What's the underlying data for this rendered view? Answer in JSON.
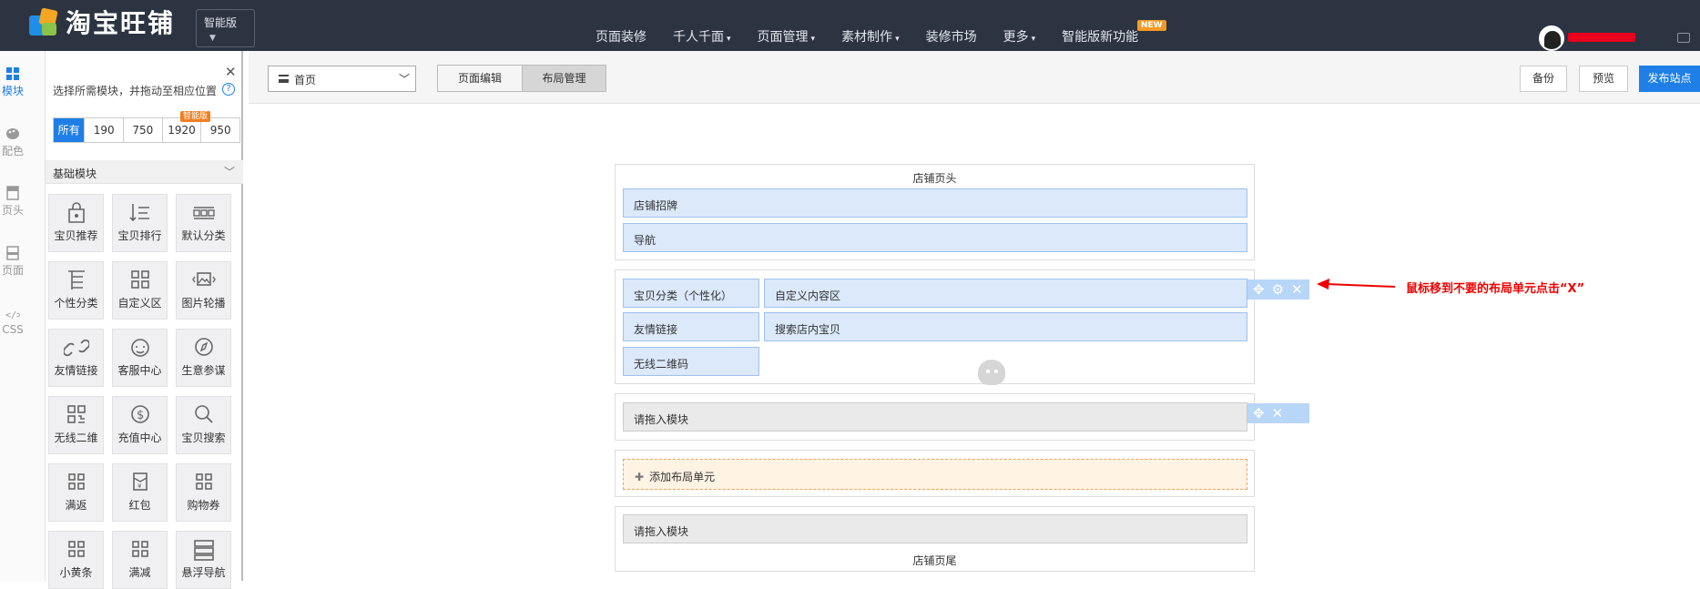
{
  "header": {
    "brand": "淘宝旺铺",
    "edition": "智能版",
    "nav": [
      {
        "label": "页面装修",
        "dropdown": false
      },
      {
        "label": "千人千面",
        "dropdown": true
      },
      {
        "label": "页面管理",
        "dropdown": true
      },
      {
        "label": "素材制作",
        "dropdown": true
      },
      {
        "label": "装修市场",
        "dropdown": false
      },
      {
        "label": "更多",
        "dropdown": true
      },
      {
        "label": "智能版新功能",
        "dropdown": false
      }
    ],
    "new_badge": "NEW",
    "username_color": "#e8001c"
  },
  "rail": {
    "items": [
      {
        "label": "模块",
        "icon": "grid-icon",
        "active": true
      },
      {
        "label": "配色",
        "icon": "palette-icon",
        "active": false
      },
      {
        "label": "页头",
        "icon": "page-header-icon",
        "active": false
      },
      {
        "label": "页面",
        "icon": "page-icon",
        "active": false
      },
      {
        "label": "CSS",
        "icon": "code-icon",
        "active": false
      }
    ]
  },
  "panel": {
    "tip": "选择所需模块，并拖动至相应位置",
    "filters": [
      "所有",
      "190",
      "750",
      "1920",
      "950"
    ],
    "smart_badge": "智能版",
    "category": "基础模块",
    "modules": [
      {
        "label": "宝贝推荐",
        "icon": "bag-icon"
      },
      {
        "label": "宝贝排行",
        "icon": "sort-icon"
      },
      {
        "label": "默认分类",
        "icon": "category-icon"
      },
      {
        "label": "个性分类",
        "icon": "tree-icon"
      },
      {
        "label": "自定义区",
        "icon": "custom-grid-icon"
      },
      {
        "label": "图片轮播",
        "icon": "carousel-icon"
      },
      {
        "label": "友情链接",
        "icon": "link-icon"
      },
      {
        "label": "客服中心",
        "icon": "customer-service-icon"
      },
      {
        "label": "生意参谋",
        "icon": "compass-icon"
      },
      {
        "label": "无线二维",
        "icon": "qrcode-icon"
      },
      {
        "label": "充值中心",
        "icon": "dollar-icon"
      },
      {
        "label": "宝贝搜索",
        "icon": "search-icon"
      },
      {
        "label": "满返",
        "icon": "grid-icon"
      },
      {
        "label": "红包",
        "icon": "red-packet-icon"
      },
      {
        "label": "购物券",
        "icon": "grid-icon"
      },
      {
        "label": "小黄条",
        "icon": "grid-icon"
      },
      {
        "label": "满减",
        "icon": "grid-icon"
      },
      {
        "label": "悬浮导航",
        "icon": "float-nav-icon"
      }
    ]
  },
  "toolbar": {
    "page": "首页",
    "tabs": [
      "页面编辑",
      "布局管理"
    ],
    "active_tab": "布局管理",
    "backup": "备份",
    "preview": "预览",
    "publish": "发布站点"
  },
  "canvas": {
    "header_title": "店铺页头",
    "header_items": [
      "店铺招牌",
      "导航"
    ],
    "unit1": {
      "left": [
        "宝贝分类（个性化）",
        "友情链接",
        "无线二维码"
      ],
      "right": [
        "自定义内容区",
        "搜索店内宝贝"
      ]
    },
    "drop_placeholder": "请拖入模块",
    "add_unit": "添加布局单元",
    "footer_placeholder": "请拖入模块",
    "footer_title": "店铺页尾"
  },
  "annotation": "鼠标移到不要的布局单元点击“X”"
}
